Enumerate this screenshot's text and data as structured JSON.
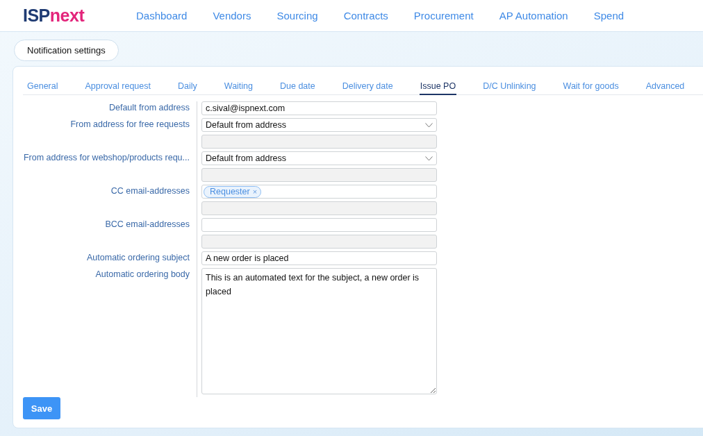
{
  "logo": {
    "primary": "ISP",
    "accent": "next"
  },
  "nav": [
    {
      "label": "Dashboard"
    },
    {
      "label": "Vendors"
    },
    {
      "label": "Sourcing"
    },
    {
      "label": "Contracts"
    },
    {
      "label": "Procurement"
    },
    {
      "label": "AP Automation"
    },
    {
      "label": "Spend"
    }
  ],
  "page_button": "Notification settings",
  "tabs": [
    {
      "label": "General",
      "selected": false
    },
    {
      "label": "Approval request",
      "selected": false
    },
    {
      "label": "Daily",
      "selected": false
    },
    {
      "label": "Waiting",
      "selected": false
    },
    {
      "label": "Due date",
      "selected": false
    },
    {
      "label": "Delivery date",
      "selected": false
    },
    {
      "label": "Issue PO",
      "selected": true
    },
    {
      "label": "D/C Unlinking",
      "selected": false
    },
    {
      "label": "Wait for goods",
      "selected": false
    },
    {
      "label": "Advanced",
      "selected": false
    }
  ],
  "fields": [
    {
      "kind": "text",
      "label": "Default from address",
      "value": "c.sival@ispnext.com"
    },
    {
      "kind": "select",
      "label": "From address for free requests",
      "value": "Default from address"
    },
    {
      "kind": "disabled"
    },
    {
      "kind": "select",
      "label": "From address for webshop/products requ...",
      "value": "Default from address"
    },
    {
      "kind": "disabled"
    },
    {
      "kind": "tags",
      "label": "CC email-addresses",
      "tags": [
        {
          "label": "Requester",
          "remove": "×"
        }
      ]
    },
    {
      "kind": "disabled"
    },
    {
      "kind": "text",
      "label": "BCC email-addresses"
    },
    {
      "kind": "disabled"
    },
    {
      "kind": "text",
      "label": "Automatic ordering subject",
      "value": "A new order is placed"
    },
    {
      "kind": "textarea",
      "label": "Automatic ordering body",
      "value": "This is an automated text for the subject, a new order is placed"
    }
  ],
  "save_button": "Save"
}
